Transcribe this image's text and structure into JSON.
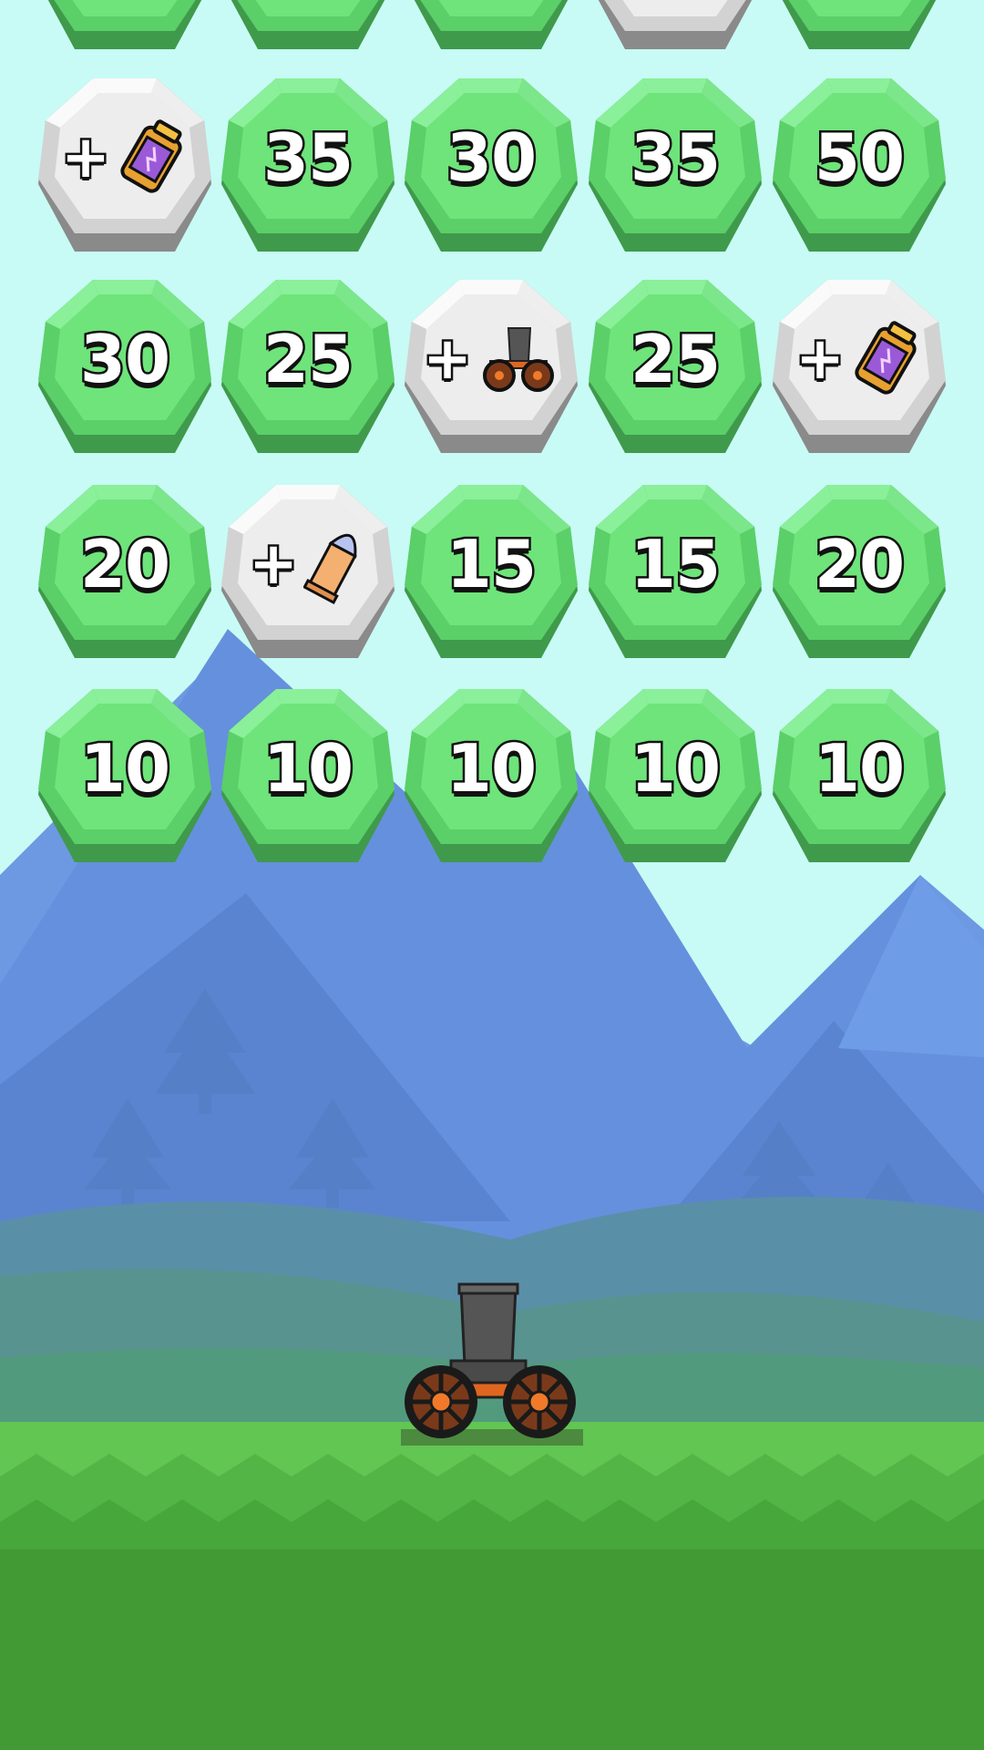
{
  "game": {
    "rows": [
      [
        {
          "kind": "number",
          "value": ""
        },
        {
          "kind": "number",
          "value": ""
        },
        {
          "kind": "number",
          "value": ""
        },
        {
          "kind": "bonus",
          "icon": "unknown-icon"
        },
        {
          "kind": "number",
          "value": ""
        }
      ],
      [
        {
          "kind": "bonus",
          "icon": "battery-powerup-icon",
          "plus": "+"
        },
        {
          "kind": "number",
          "value": "35"
        },
        {
          "kind": "number",
          "value": "30"
        },
        {
          "kind": "number",
          "value": "35"
        },
        {
          "kind": "number",
          "value": "50"
        }
      ],
      [
        {
          "kind": "number",
          "value": "30"
        },
        {
          "kind": "number",
          "value": "25"
        },
        {
          "kind": "bonus",
          "icon": "cannon-powerup-icon",
          "plus": "+"
        },
        {
          "kind": "number",
          "value": "25"
        },
        {
          "kind": "bonus",
          "icon": "battery-powerup-icon",
          "plus": "+"
        }
      ],
      [
        {
          "kind": "number",
          "value": "20"
        },
        {
          "kind": "bonus",
          "icon": "bullet-powerup-icon",
          "plus": "+"
        },
        {
          "kind": "number",
          "value": "15"
        },
        {
          "kind": "number",
          "value": "15"
        },
        {
          "kind": "number",
          "value": "20"
        }
      ],
      [
        {
          "kind": "number",
          "value": "10"
        },
        {
          "kind": "number",
          "value": "10"
        },
        {
          "kind": "number",
          "value": "10"
        },
        {
          "kind": "number",
          "value": "10"
        },
        {
          "kind": "number",
          "value": "10"
        }
      ]
    ]
  },
  "colors": {
    "sky": "#c8fbf5",
    "gem_green": "#6ee47a",
    "gem_white": "#f2f2f2",
    "mountain": "#6590dd",
    "grass": "#5cc24a",
    "ground": "#419a33"
  }
}
